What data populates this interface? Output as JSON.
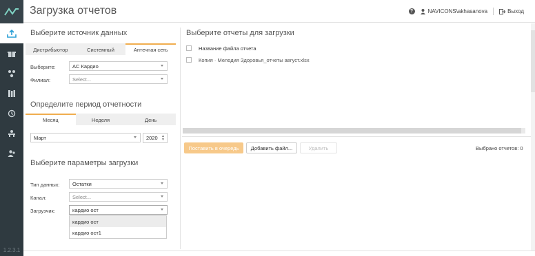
{
  "app": {
    "title": "Загрузка отчетов",
    "user": "NAVICONS\\akhasanova",
    "logout": "Выход",
    "version": "1.2.3.1"
  },
  "source": {
    "title": "Выберите источник данных",
    "tabs": [
      "Дистрибьютор",
      "Системный",
      "Аптечная сеть"
    ],
    "selected_tab": 2,
    "choose_label": "Выберите:",
    "choose_value": "AC Кардио",
    "branch_label": "Филиал:",
    "branch_value": "Select..."
  },
  "period": {
    "title": "Определите период отчетности",
    "tabs": [
      "Месяц",
      "Неделя",
      "День"
    ],
    "selected_tab": 0,
    "month_value": "Март",
    "year_value": "2020"
  },
  "params": {
    "title": "Выберите параметры загрузки",
    "data_type_label": "Тип данных:",
    "data_type_value": "Остатки",
    "channel_label": "Канал:",
    "channel_value": "Select...",
    "loader_label": "Загрузчик:",
    "loader_value": "кардио ост",
    "loader_options": [
      "кардио ост",
      "кардио ост1"
    ]
  },
  "reports": {
    "title": "Выберите отчеты для загрузки",
    "col_header": "Название файла отчета",
    "files": [
      "Копия · Мелодия Здоровья_отчеты август.xlsx"
    ],
    "btn_queue": "Поставить в очередь",
    "btn_add": "Добавить файл...",
    "btn_delete": "Удалить",
    "selected_count": "Выбрано отчетов: 0"
  },
  "icons": [
    "logo-icon",
    "upload-icon",
    "gift-icon",
    "network-icon",
    "books-icon",
    "history-icon",
    "tree-icon",
    "users-icon",
    "help-icon",
    "user-icon",
    "logout-icon"
  ]
}
